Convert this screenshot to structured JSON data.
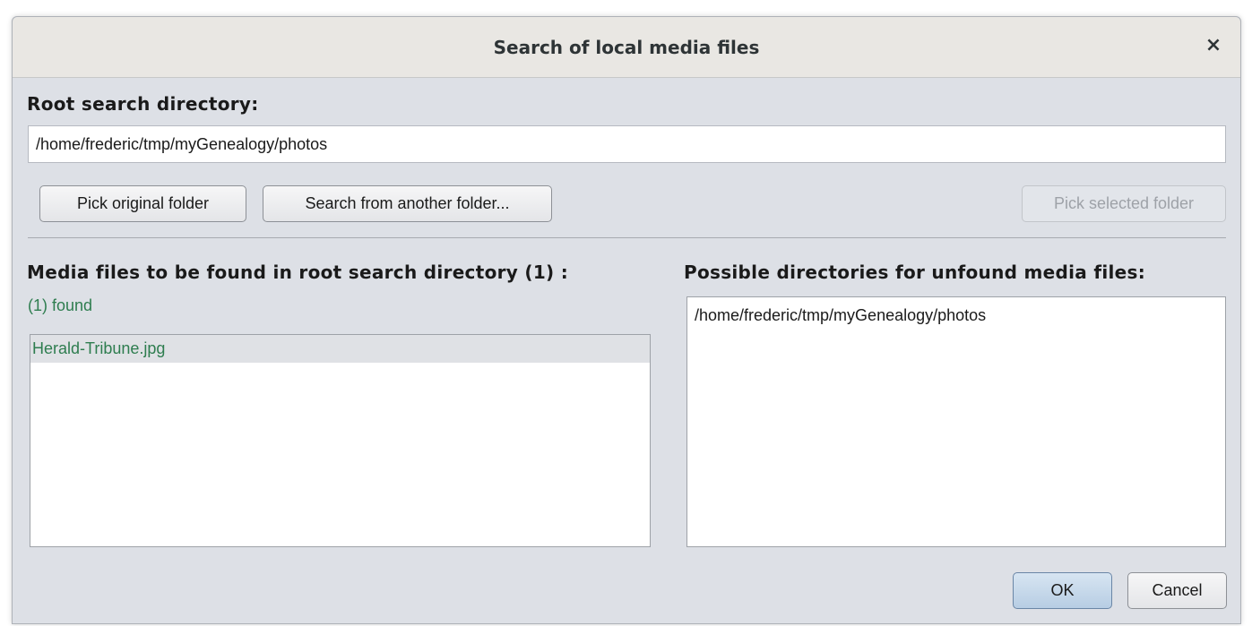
{
  "dialog": {
    "title": "Search of local media files",
    "close_symbol": "×"
  },
  "root": {
    "heading": "Root search directory:",
    "path_value": "/home/frederic/tmp/myGenealogy/photos"
  },
  "buttons": {
    "pick_original": "Pick original folder",
    "search_another": "Search from another folder...",
    "pick_selected": "Pick selected folder",
    "ok": "OK",
    "cancel": "Cancel"
  },
  "media": {
    "heading": "Media files to be found in root search directory (1) :",
    "found_label": "(1) found",
    "files": [
      "Herald-Tribune.jpg"
    ]
  },
  "directories": {
    "heading": "Possible directories for unfound media files:",
    "items": [
      "/home/frederic/tmp/myGenealogy/photos"
    ]
  },
  "colors": {
    "found_text": "#2e7d4f",
    "dialog_bg": "#dde0e6",
    "titlebar_bg": "#e9e7e3"
  },
  "icons": {
    "close": "close-icon"
  }
}
